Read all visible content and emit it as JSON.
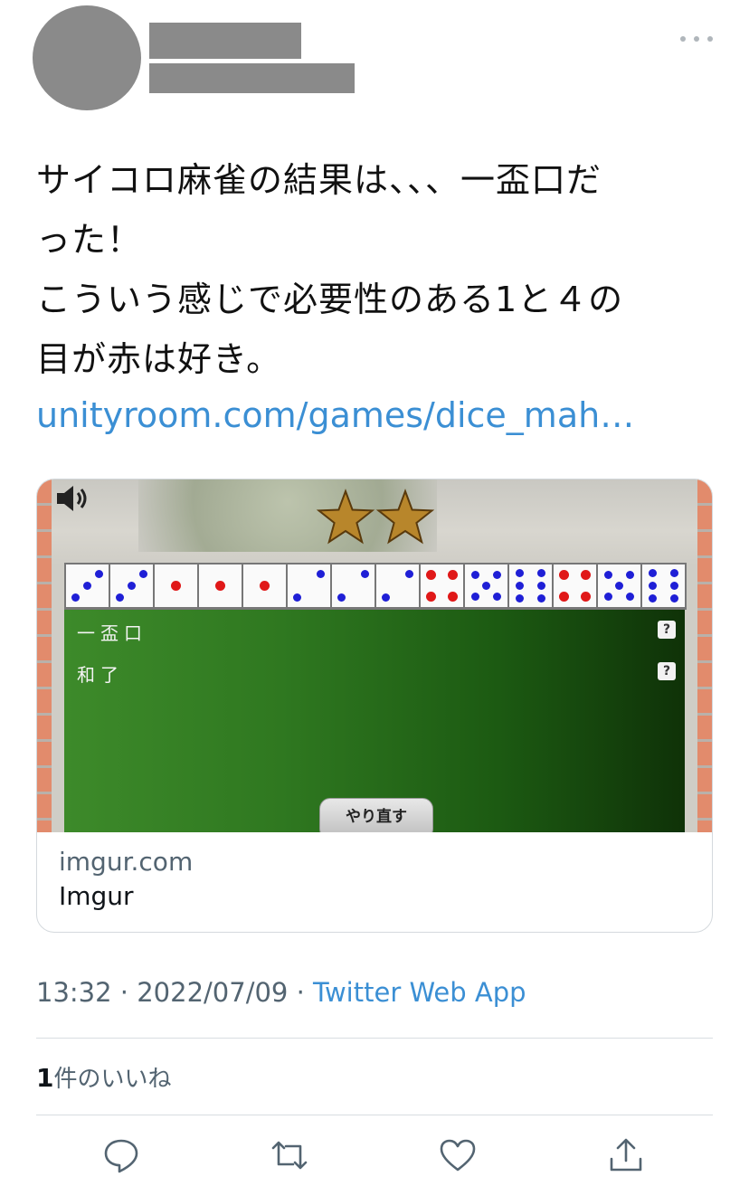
{
  "tweet": {
    "text_lines": [
      "サイコロ麻雀の結果は、、、一盃口だ",
      "った！",
      "こういう感じで必要性のある1と４の",
      "目が赤は好き。"
    ],
    "link": "unityroom.com/games/dice_mah…"
  },
  "card": {
    "domain": "imgur.com",
    "title": "Imgur",
    "game": {
      "yaku": [
        "一盃口",
        "和了"
      ],
      "help_label": "?",
      "redo_button": "やり直す",
      "stars": 2,
      "dice": [
        3,
        3,
        1,
        1,
        1,
        2,
        2,
        2,
        4,
        5,
        6,
        4,
        5,
        6
      ]
    }
  },
  "meta": {
    "time": "13:32",
    "separator": "·",
    "date": "2022/07/09",
    "source": "Twitter Web App"
  },
  "likes": {
    "count": "1",
    "label": "件のいいね"
  },
  "colors": {
    "link": "#3b8fd4",
    "muted": "#536471",
    "redacted": "#8a8a8a"
  },
  "icons": [
    "more-icon",
    "reply-icon",
    "retweet-icon",
    "like-icon",
    "share-icon",
    "speaker-icon",
    "star-icon"
  ]
}
